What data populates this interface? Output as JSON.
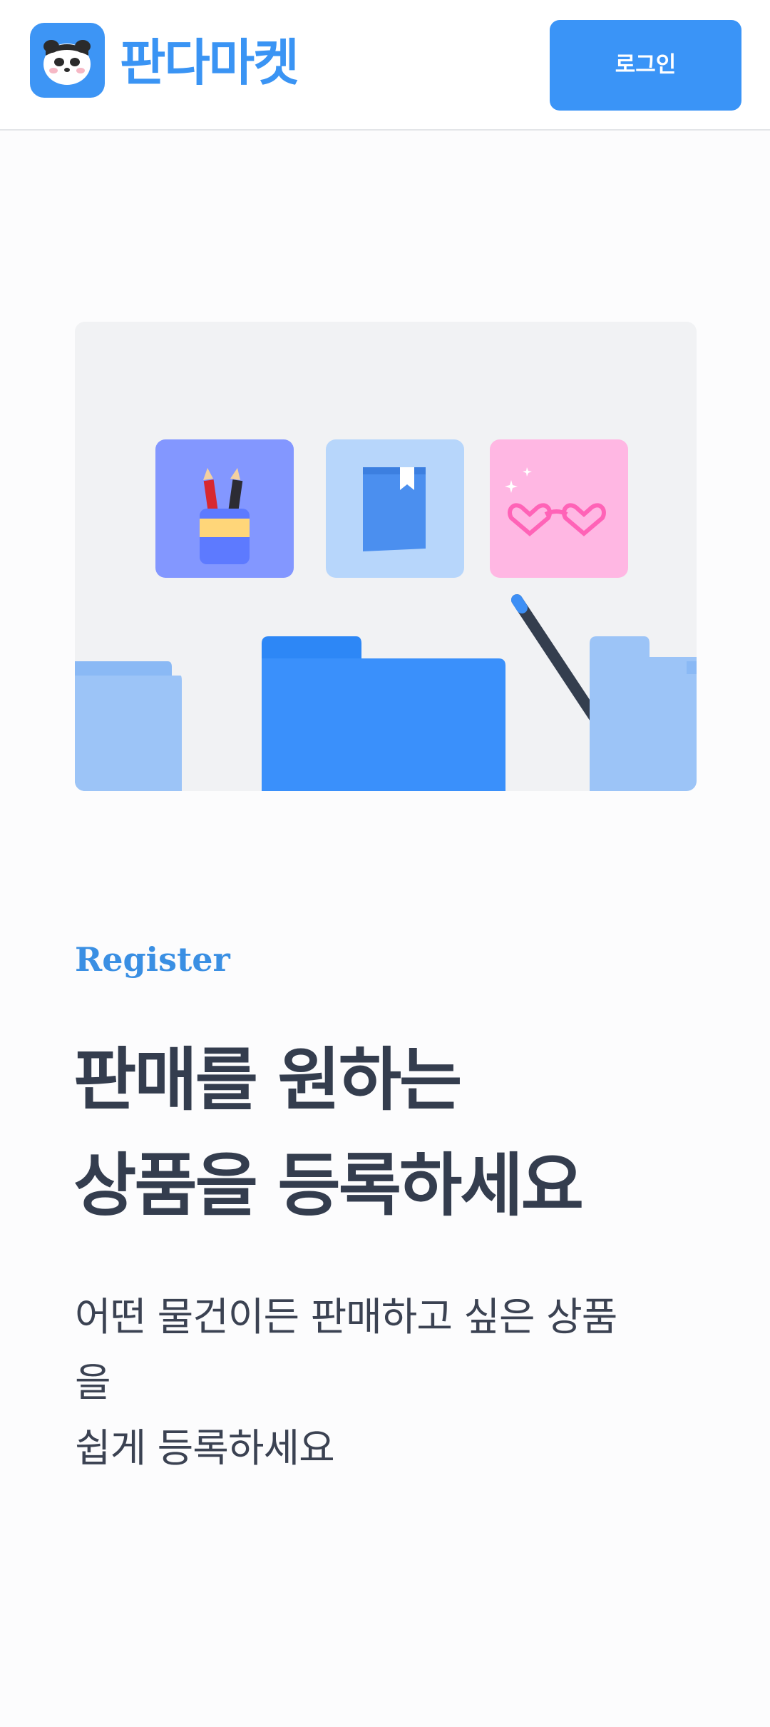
{
  "header": {
    "brand_name": "판다마켓",
    "logo_icon": "panda-face-icon",
    "login_label": "로그인"
  },
  "hero": {
    "illustration": "product-registration-illustration",
    "tiles": [
      "pencil-cup-icon",
      "book-icon",
      "heart-glasses-icon"
    ]
  },
  "section": {
    "eyebrow": "Register",
    "headline_line1": "판매를 원하는",
    "headline_line2": "상품을 등록하세요",
    "desc_line1": "어떤 물건이든 판매하고 싶은 상품",
    "desc_line2": "을",
    "desc_line3": "쉽게 등록하세요"
  },
  "colors": {
    "brand": "#3692FF",
    "heading": "#374151",
    "background": "#FCFCFD"
  }
}
